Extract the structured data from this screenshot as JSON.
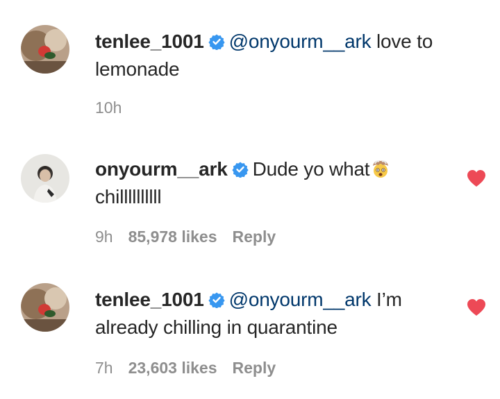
{
  "comments": [
    {
      "username": "tenlee_1001",
      "verified": true,
      "mention": "@onyourm__ark",
      "text_line1": " love to",
      "text_line2": "lemonade",
      "time": "10h",
      "likes": "",
      "reply": "",
      "liked": false
    },
    {
      "username": "onyourm__ark",
      "verified": true,
      "mention": "",
      "text_line1": "Dude yo what",
      "text_line2": "chillllllllll",
      "emoji": "exploding-head-emoji",
      "time": "9h",
      "likes": "85,978 likes",
      "reply": "Reply",
      "liked": true
    },
    {
      "username": "tenlee_1001",
      "verified": true,
      "mention": "@onyourm__ark",
      "text_line1": " I’m",
      "text_line2": "already chilling in quarantine",
      "time": "7h",
      "likes": "23,603 likes",
      "reply": "Reply",
      "liked": true
    }
  ],
  "colors": {
    "username": "#262626",
    "mention": "#00376b",
    "meta": "#8e8e8e",
    "verified": "#3897f0",
    "heart": "#ed4956"
  }
}
